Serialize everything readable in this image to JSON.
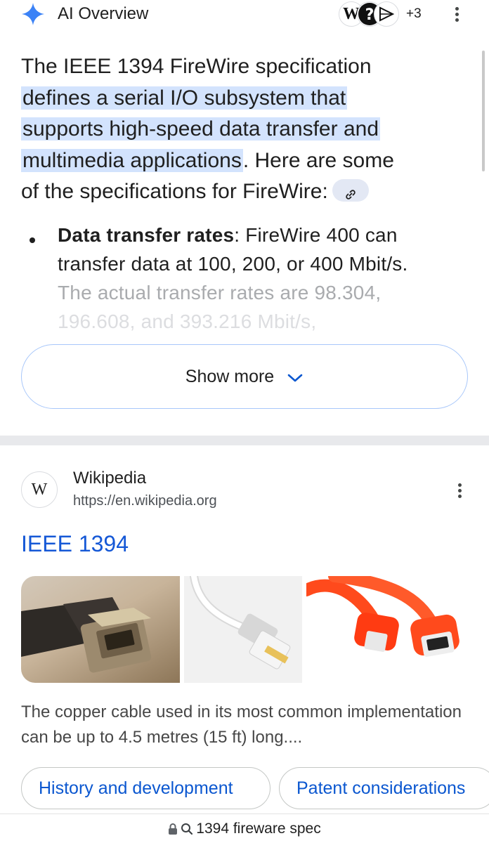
{
  "ai_overview": {
    "title": "AI Overview",
    "sources_more": "+3",
    "source_icons": [
      "wikipedia-icon",
      "question-icon",
      "diamond-icon"
    ],
    "intro_before": "The IEEE 1394 FireWire specification",
    "intro_highlight_1": "defines a serial I/O subsystem that",
    "intro_highlight_2": "supports high-speed data transfer and",
    "intro_highlight_3": "multimedia applications",
    "intro_after_1": ". Here are some",
    "intro_after_2": "of the specifications for FireWire:",
    "bullet": {
      "term": "Data transfer rates",
      "text_line1": ": FireWire 400 can",
      "text_line2": "transfer data at 100, 200, or 400 Mbit/s.",
      "text_line3": "The actual transfer rates are 98.304,",
      "text_line4": "196.608, and 393.216 Mbit/s,"
    },
    "show_more": "Show more"
  },
  "result": {
    "site_name": "Wikipedia",
    "site_logo": "W",
    "url": "https://en.wikipedia.org",
    "title": "IEEE 1394",
    "images": [
      "firewire-connector-photo",
      "ethernet-cable-photo",
      "red-firewire-cables-photo"
    ],
    "snippet": "The copper cable used in its most common implementation can be up to 4.5 metres (15 ft) long....",
    "chips": [
      "History and development",
      "Patent considerations"
    ]
  },
  "urlbar": {
    "text": "1394 fireware spec"
  },
  "colors": {
    "highlight": "#d3e3fd",
    "link": "#1558d6",
    "chip_text": "#0b57d0",
    "spark": "#4285f4"
  }
}
